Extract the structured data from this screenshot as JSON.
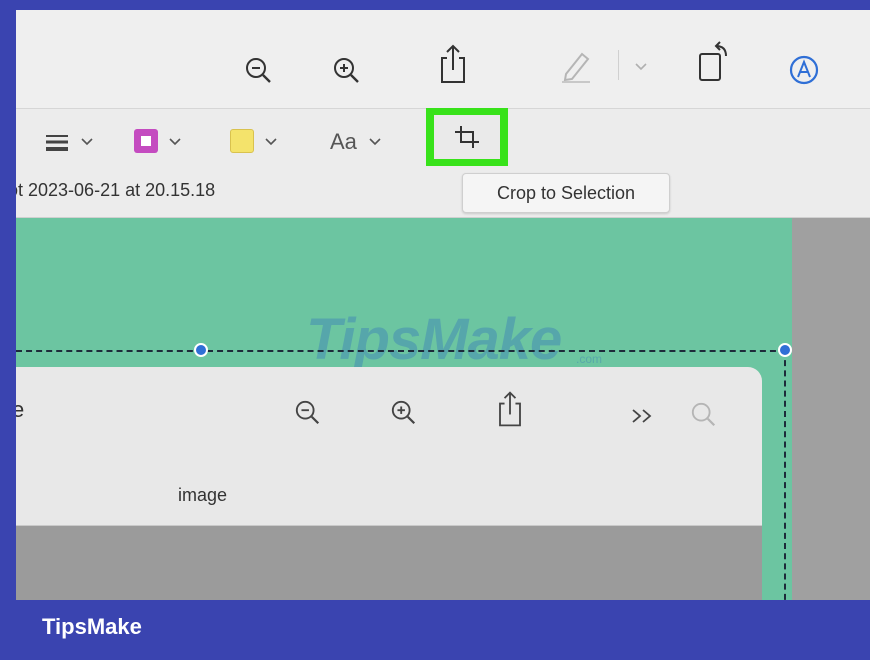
{
  "toolbar": {
    "zoom_out_icon": "zoom-out-icon",
    "zoom_in_icon": "zoom-in-icon",
    "share_icon": "share-icon",
    "markup_icon": "pencil-icon",
    "rotate_icon": "rotate-icon",
    "annotate_icon": "annotate-icon"
  },
  "markup_toolbar": {
    "line_style_icon": "line-style-icon",
    "border_color": "#c44bc0",
    "fill_color": "#f4e36b",
    "font_label": "Aa",
    "crop_icon": "crop-icon",
    "crop_highlight_color": "#38e21a"
  },
  "document": {
    "filename_label": "ot 2023-06-21 at 20.15.18"
  },
  "tooltip": {
    "text": "Crop to Selection"
  },
  "inner_window": {
    "title_fragment": "e",
    "subtitle": "image"
  },
  "watermark": {
    "text": "TipsMake",
    "small": ".com"
  },
  "footer": {
    "brand": "TipsMake"
  },
  "colors": {
    "frame": "#3a44b0",
    "canvas_green": "#6cc5a1",
    "selection_handle": "#2f6fd6"
  }
}
